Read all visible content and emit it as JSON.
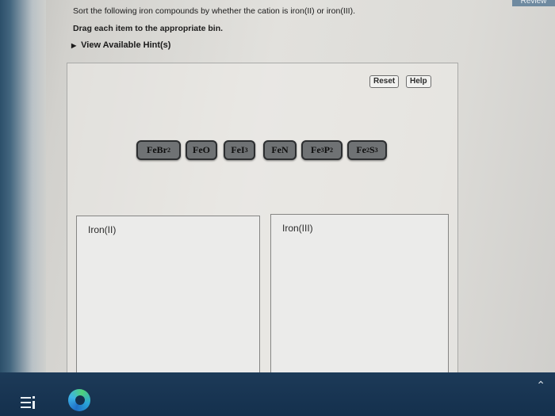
{
  "corner_label": "Review",
  "instructions": {
    "line1": "Sort the following iron compounds by whether the cation is iron(II) or iron(III).",
    "line2": "Drag each item to the appropriate bin."
  },
  "hints": {
    "label": "View Available Hint(s)"
  },
  "toolbar": {
    "reset_label": "Reset",
    "help_label": "Help"
  },
  "items": [
    {
      "base": "FeBr",
      "sub": "2",
      "rest": "",
      "rest_sub": ""
    },
    {
      "base": "FeO",
      "sub": "",
      "rest": "",
      "rest_sub": ""
    },
    {
      "base": "FeI",
      "sub": "3",
      "rest": "",
      "rest_sub": ""
    },
    {
      "base": "FeN",
      "sub": "",
      "rest": "",
      "rest_sub": ""
    },
    {
      "base": "Fe",
      "sub": "3",
      "rest": "P",
      "rest_sub": "2"
    },
    {
      "base": "Fe",
      "sub": "2",
      "rest": "S",
      "rest_sub": "3"
    }
  ],
  "bins": [
    {
      "label": "Iron(II)"
    },
    {
      "label": "Iron(III)"
    }
  ],
  "colors": {
    "tile_bg": "#6f7274",
    "taskbar": "#1d3a58"
  },
  "icons": [
    "task-view-icon",
    "edge-browser-icon",
    "chevron-up-icon"
  ]
}
